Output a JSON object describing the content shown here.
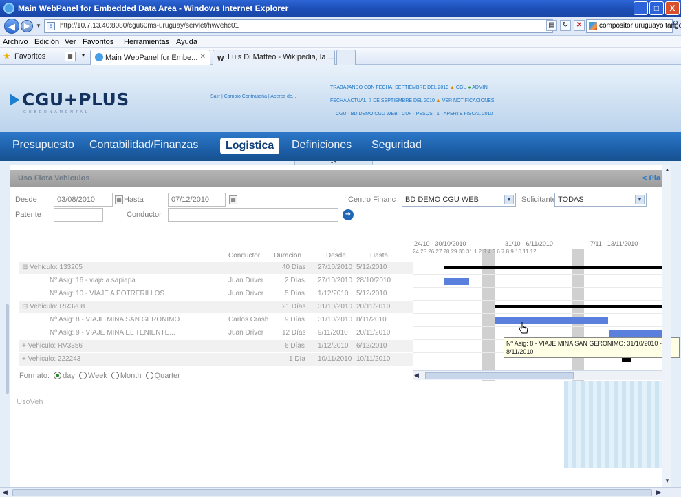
{
  "window": {
    "title": "Main WebPanel for Embedded Data Area - Windows Internet Explorer",
    "minimize": "_",
    "maximize": "□",
    "close": "X"
  },
  "addressbar": {
    "url": "http://10.7.13.40:8080/cgu60ms-uruguay/servlet/hwvehc01",
    "search_value": "compositor uruguayo tango"
  },
  "menu": [
    "Archivo",
    "Edición",
    "Ver",
    "Favoritos",
    "Herramientas",
    "Ayuda"
  ],
  "favorites": {
    "label": "Favoritos",
    "tabs": [
      {
        "label": "Main WebPanel for Embe..."
      },
      {
        "label": "Luis Di Matteo - Wikipedia, la ..."
      }
    ]
  },
  "header": {
    "logo": "CGU+PLUS",
    "logo_sub": "GUBERNAMENTAL",
    "links": "Salir | Cambio Contraseña | Acerca de...",
    "info1": "TRABAJANDO CON FECHA: SEPTIEMBRE DEL 2010",
    "info1_user": "CGU",
    "info1_app": "ADMIN",
    "info2": "FECHA ACTUAL: 7 DE SEPTIEMBRE DEL 2010",
    "info2_link": "VER NOTIFICACIONES",
    "info3": "CGU · BD DEMO CGU WEB · CUF · PESOS · 1 · APERTE FISCAL 2010"
  },
  "nav": {
    "items": [
      "Presupuesto",
      "Contabilidad/Finanzas",
      "Logistica",
      "Definiciones",
      "Seguridad"
    ],
    "active": "Logistica"
  },
  "section": {
    "title": "Uso Flota Vehiculos",
    "link": "< Pla"
  },
  "filters": {
    "desde_label": "Desde",
    "desde_value": "03/08/2010",
    "hasta_label": "Hasta",
    "hasta_value": "07/12/2010",
    "centro_label": "Centro Financ",
    "centro_value": "BD DEMO CGU WEB",
    "solicitante_label": "Solicitante",
    "solicitante_value": "TODAS",
    "patente_label": "Patente",
    "conductor_label": "Conductor",
    "patente_value": "",
    "conductor_value": ""
  },
  "gantt": {
    "columns": [
      "Conductor",
      "Duración",
      "Desde",
      "Hasta"
    ],
    "periods": [
      "24/10 - 30/10/2010",
      "31/10 - 6/11/2010",
      "7/11 - 13/11/2010"
    ],
    "days": "24 25 26 27 28 29 30 31 1 2 3 4 5 6 7 8 9 10 11 12",
    "rows": [
      {
        "name": "⊟ Vehiculo: 133205",
        "conductor": "",
        "duracion": "40 Días",
        "desde": "27/10/2010",
        "hasta": "5/12/2010",
        "shaded": true
      },
      {
        "name": "Nº Asig: 16 - viaje a sapiapa",
        "conductor": "Juan Driver",
        "duracion": "2 Días",
        "desde": "27/10/2010",
        "hasta": "28/10/2010",
        "shaded": false
      },
      {
        "name": "Nº Asig: 10 - VIAJE A POTRERILLOS",
        "conductor": "Juan Driver",
        "duracion": "5 Días",
        "desde": "1/12/2010",
        "hasta": "5/12/2010",
        "shaded": false
      },
      {
        "name": "⊟ Vehiculo: RR3208",
        "conductor": "",
        "duracion": "21 Días",
        "desde": "31/10/2010",
        "hasta": "20/11/2010",
        "shaded": true
      },
      {
        "name": "Nº Asig: 8 - VIAJE MINA SAN GERONIMO",
        "conductor": "Carlos Crash",
        "duracion": "9 Días",
        "desde": "31/10/2010",
        "hasta": "8/11/2010",
        "shaded": false
      },
      {
        "name": "Nº Asig: 9 - VIAJE MINA EL TENIENTE...",
        "conductor": "Juan Driver",
        "duracion": "12 Días",
        "desde": "9/11/2010",
        "hasta": "20/11/2010",
        "shaded": false
      },
      {
        "name": "+ Vehiculo: RV3356",
        "conductor": "",
        "duracion": "6 Días",
        "desde": "1/12/2010",
        "hasta": "6/12/2010",
        "shaded": true
      },
      {
        "name": "+ Vehiculo: 222243",
        "conductor": "",
        "duracion": "1 Día",
        "desde": "10/11/2010",
        "hasta": "10/11/2010",
        "shaded": true
      }
    ],
    "format_label": "Formato:",
    "formats": [
      "day",
      "Week",
      "Month",
      "Quarter"
    ],
    "tooltip": "Nº Asig: 8 - VIAJE MINA SAN GERONIMO: 31/10/2010 - 8/11/2010"
  },
  "footer": {
    "label": "UsoVeh"
  }
}
